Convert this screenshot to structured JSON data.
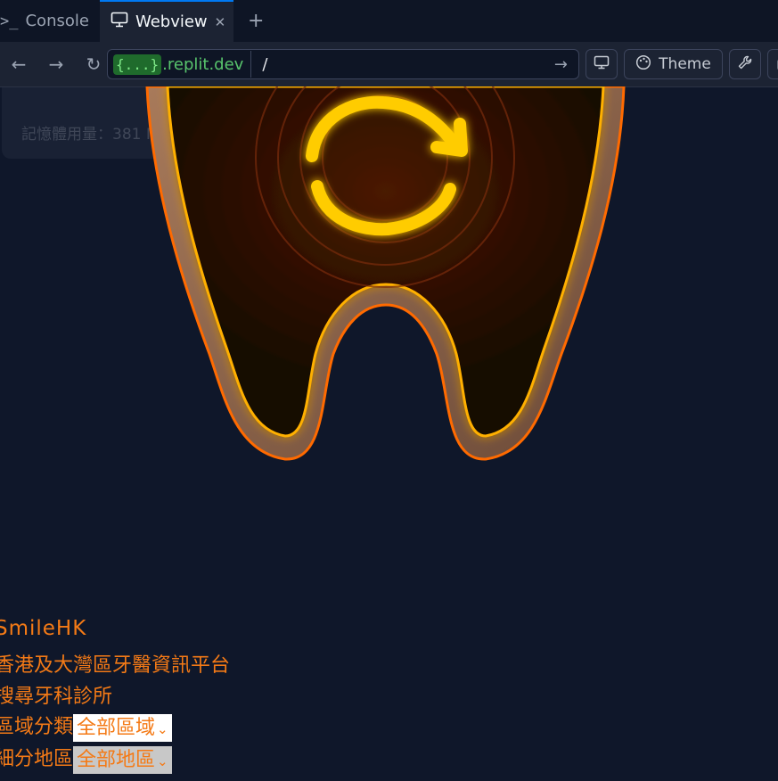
{
  "tabs": {
    "console_label": "Console",
    "webview_label": "Webview"
  },
  "url": {
    "prefix": "{...}",
    "host": ".replit.dev",
    "path": "/"
  },
  "toolbar": {
    "theme_label": "Theme"
  },
  "ghost_panel": {
    "memory_text": "記憶體用量：381 MB"
  },
  "page": {
    "brand": "SmileHK",
    "subtitle": "香港及大灣區牙醫資訊平台",
    "search_heading": "搜尋牙科診所",
    "region_label": "區域分類",
    "region_value": "全部區域",
    "district_label": "細分地區",
    "district_value": "全部地區"
  },
  "colors": {
    "accent": "#f47a16",
    "background": "#0f172a",
    "refresh_icon": "#ffcc00"
  }
}
